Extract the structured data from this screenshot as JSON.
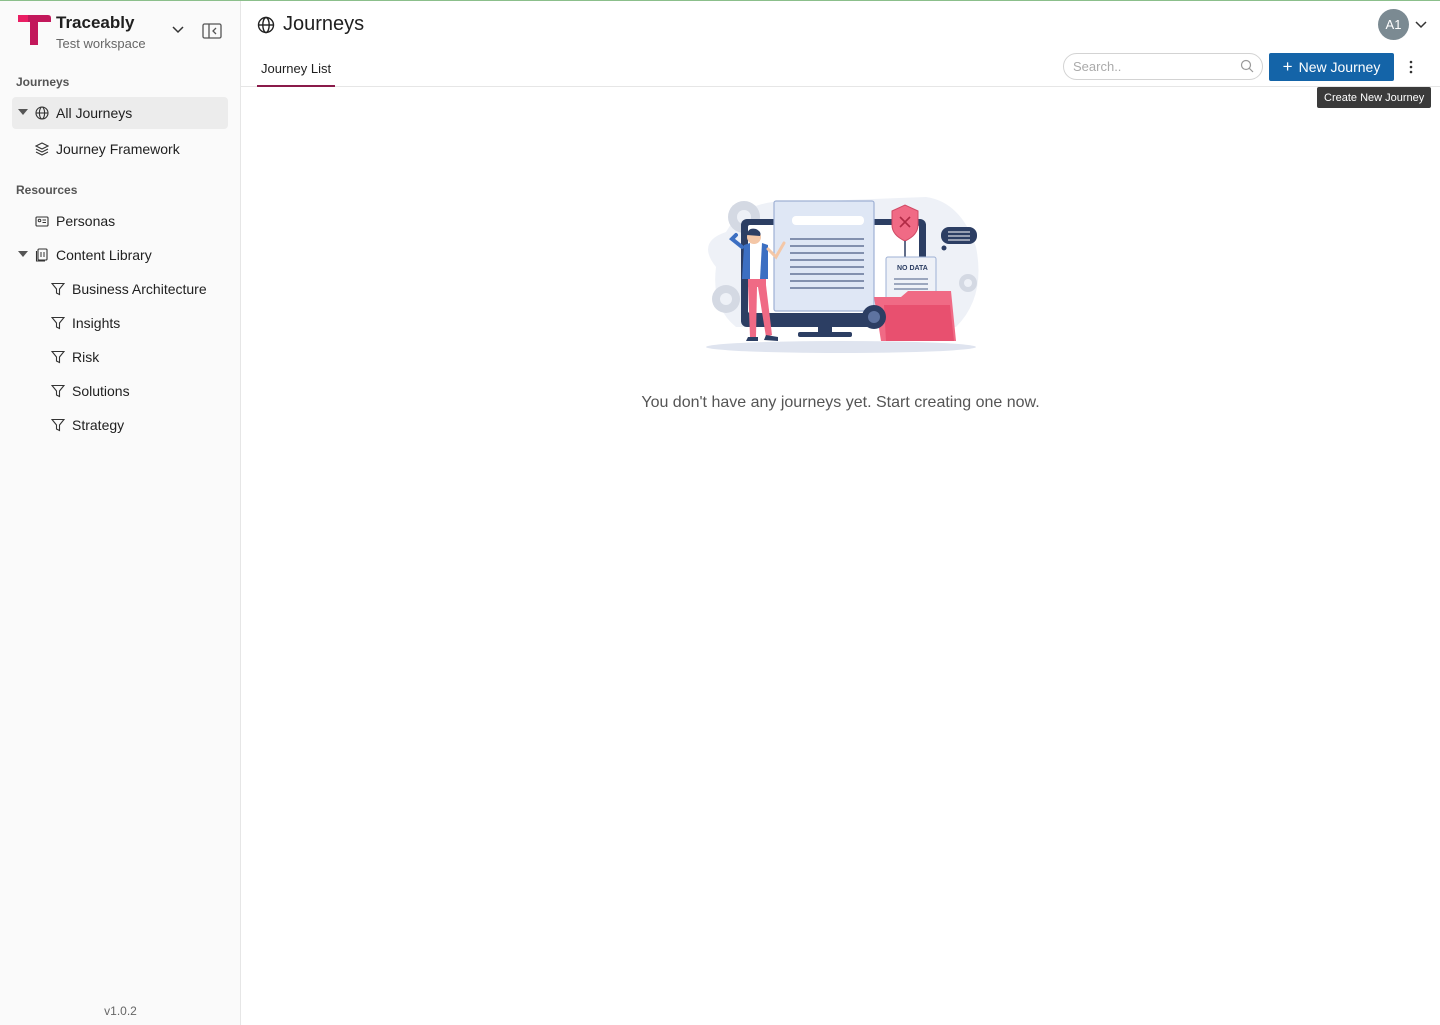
{
  "brand": {
    "name": "Traceably",
    "workspace": "Test workspace",
    "logo_color": "#c2185b"
  },
  "sidebar": {
    "journeys_section": "Journeys",
    "journeys_items": [
      {
        "label": "All Journeys",
        "icon": "globe-icon",
        "active": true,
        "expanded": true
      },
      {
        "label": "Journey Framework",
        "icon": "layers-icon"
      }
    ],
    "resources_section": "Resources",
    "resources_items": [
      {
        "label": "Personas",
        "icon": "id-card-icon"
      },
      {
        "label": "Content Library",
        "icon": "library-icon",
        "expanded": true
      },
      {
        "label": "Business Architecture",
        "icon": "filter-icon"
      },
      {
        "label": "Insights",
        "icon": "filter-icon"
      },
      {
        "label": "Risk",
        "icon": "filter-icon"
      },
      {
        "label": "Solutions",
        "icon": "filter-icon"
      },
      {
        "label": "Strategy",
        "icon": "filter-icon"
      }
    ],
    "version": "v1.0.2"
  },
  "header": {
    "title": "Journeys",
    "title_icon": "globe-icon",
    "avatar_initials": "A1"
  },
  "tabs": [
    {
      "label": "Journey List",
      "active": true
    }
  ],
  "toolbar": {
    "search_placeholder": "Search..",
    "search_value": "",
    "new_button_label": "New Journey",
    "new_button_tooltip": "Create New Journey",
    "accent": "#1464a8"
  },
  "empty_state": {
    "illustration_label": "NO DATA",
    "message": "You don't have any journeys yet. Start creating one now."
  }
}
